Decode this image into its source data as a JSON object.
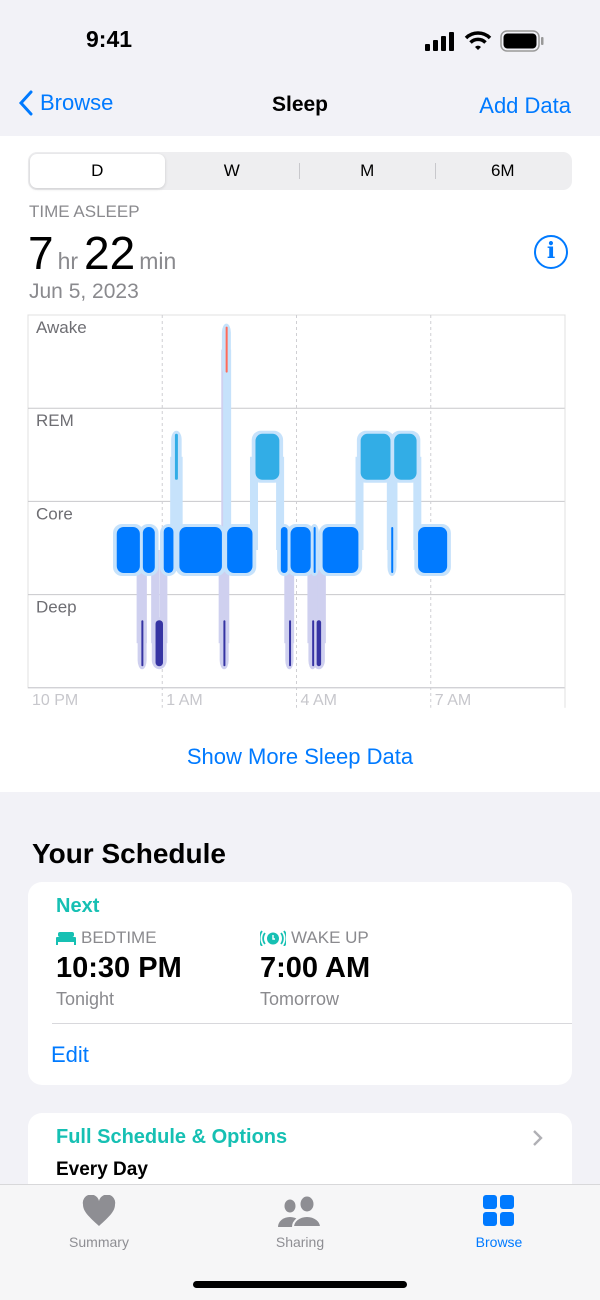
{
  "status": {
    "time": "9:41"
  },
  "nav": {
    "back_label": "Browse",
    "title": "Sleep",
    "action_label": "Add Data"
  },
  "segments": [
    "D",
    "W",
    "M",
    "6M"
  ],
  "selected_segment": "D",
  "summary": {
    "label": "TIME ASLEEP",
    "hours": "7",
    "hours_unit": "hr",
    "minutes": "22",
    "minutes_unit": "min",
    "date": "Jun 5, 2023"
  },
  "chart_data": {
    "type": "sleep-stages timeline",
    "stages": [
      "Awake",
      "REM",
      "Core",
      "Deep"
    ],
    "stage_colors": {
      "Awake": "#ff6b5a",
      "REM": "#32ade6",
      "Core": "#007aff",
      "Deep": "#3634a3"
    },
    "x_range": [
      "22:00",
      "10:00"
    ],
    "x_ticks": [
      "10 PM",
      "1 AM",
      "4 AM",
      "7 AM"
    ],
    "segments": [
      {
        "stage": "Core",
        "start": "23:58",
        "end": "00:31"
      },
      {
        "stage": "Deep",
        "start": "00:31",
        "end": "00:35"
      },
      {
        "stage": "Core",
        "start": "00:33",
        "end": "00:51"
      },
      {
        "stage": "Deep",
        "start": "00:50",
        "end": "01:02"
      },
      {
        "stage": "Core",
        "start": "01:01",
        "end": "01:16"
      },
      {
        "stage": "REM",
        "start": "01:16",
        "end": "01:22"
      },
      {
        "stage": "Core",
        "start": "01:22",
        "end": "02:21"
      },
      {
        "stage": "Deep",
        "start": "02:21",
        "end": "02:25"
      },
      {
        "stage": "Awake",
        "start": "02:24",
        "end": "02:28"
      },
      {
        "stage": "Core",
        "start": "02:26",
        "end": "03:02"
      },
      {
        "stage": "REM",
        "start": "03:04",
        "end": "03:38"
      },
      {
        "stage": "Core",
        "start": "03:38",
        "end": "03:49"
      },
      {
        "stage": "Deep",
        "start": "03:49",
        "end": "03:52"
      },
      {
        "stage": "Core",
        "start": "03:51",
        "end": "04:20"
      },
      {
        "stage": "Deep",
        "start": "04:20",
        "end": "04:23"
      },
      {
        "stage": "Core",
        "start": "04:22",
        "end": "04:26"
      },
      {
        "stage": "Deep",
        "start": "04:26",
        "end": "04:34"
      },
      {
        "stage": "Core",
        "start": "04:34",
        "end": "05:24"
      },
      {
        "stage": "REM",
        "start": "05:25",
        "end": "06:07"
      },
      {
        "stage": "Core",
        "start": "06:06",
        "end": "06:10"
      },
      {
        "stage": "REM",
        "start": "06:10",
        "end": "06:42"
      },
      {
        "stage": "Core",
        "start": "06:42",
        "end": "07:23"
      }
    ]
  },
  "show_more_label": "Show More Sleep Data",
  "schedule": {
    "title": "Your Schedule",
    "next_label": "Next",
    "bedtime": {
      "label": "BEDTIME",
      "time": "10:30 PM",
      "day": "Tonight",
      "icon": "bed-icon"
    },
    "wakeup": {
      "label": "WAKE UP",
      "time": "7:00 AM",
      "day": "Tomorrow",
      "icon": "alarm-icon"
    },
    "edit_label": "Edit",
    "full_label": "Full Schedule & Options",
    "full_sub": "Every Day"
  },
  "tabs": [
    {
      "label": "Summary",
      "icon": "heart-icon"
    },
    {
      "label": "Sharing",
      "icon": "people-icon"
    },
    {
      "label": "Browse",
      "icon": "grid-icon",
      "active": true
    }
  ],
  "colors": {
    "accent": "#007aff",
    "teal": "#16c0b3"
  }
}
